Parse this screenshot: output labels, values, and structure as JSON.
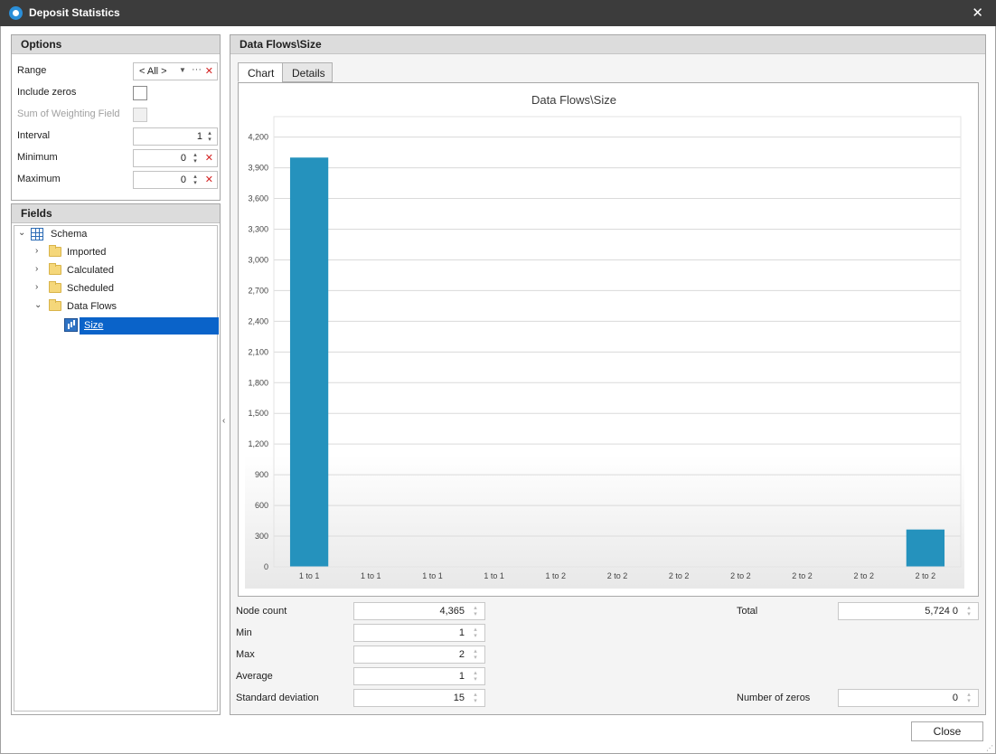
{
  "window": {
    "title": "Deposit Statistics",
    "close_glyph": "✕"
  },
  "options": {
    "header": "Options",
    "range_label": "Range",
    "range_value": "< All >",
    "include_zeros_label": "Include zeros",
    "sum_weighting_label": "Sum of Weighting Field",
    "interval_label": "Interval",
    "interval_value": "1",
    "minimum_label": "Minimum",
    "minimum_value": "0",
    "maximum_label": "Maximum",
    "maximum_value": "0"
  },
  "fields": {
    "header": "Fields",
    "root": "Schema",
    "items": [
      "Imported",
      "Calculated",
      "Scheduled",
      "Data Flows"
    ],
    "selected": "Size"
  },
  "panel": {
    "header": "Data Flows\\Size",
    "tabs": [
      "Chart",
      "Details"
    ],
    "active_tab": "Chart"
  },
  "chart_data": {
    "type": "bar",
    "title": "Data Flows\\Size",
    "categories": [
      "1 to 1",
      "1 to 1",
      "1 to 1",
      "1 to 1",
      "1 to 2",
      "2 to 2",
      "2 to 2",
      "2 to 2",
      "2 to 2",
      "2 to 2",
      "2 to 2"
    ],
    "values": [
      4000,
      0,
      0,
      0,
      0,
      0,
      0,
      0,
      0,
      0,
      365
    ],
    "yticks": [
      "0",
      "300",
      "600",
      "900",
      "1,200",
      "1,500",
      "1,800",
      "2,100",
      "2,400",
      "2,700",
      "3,000",
      "3,300",
      "3,600",
      "3,900",
      "4,200"
    ],
    "ylim": [
      0,
      4400
    ],
    "bar_color": "#2592bd",
    "grid": true
  },
  "stats": {
    "node_count_label": "Node count",
    "node_count": "4,365",
    "min_label": "Min",
    "min": "1",
    "max_label": "Max",
    "max": "2",
    "average_label": "Average",
    "average": "1",
    "std_label": "Standard deviation",
    "std": "15",
    "total_label": "Total",
    "total": "5,724 0",
    "zeros_label": "Number of zeros",
    "zeros": "0"
  },
  "footer": {
    "close_label": "Close"
  }
}
